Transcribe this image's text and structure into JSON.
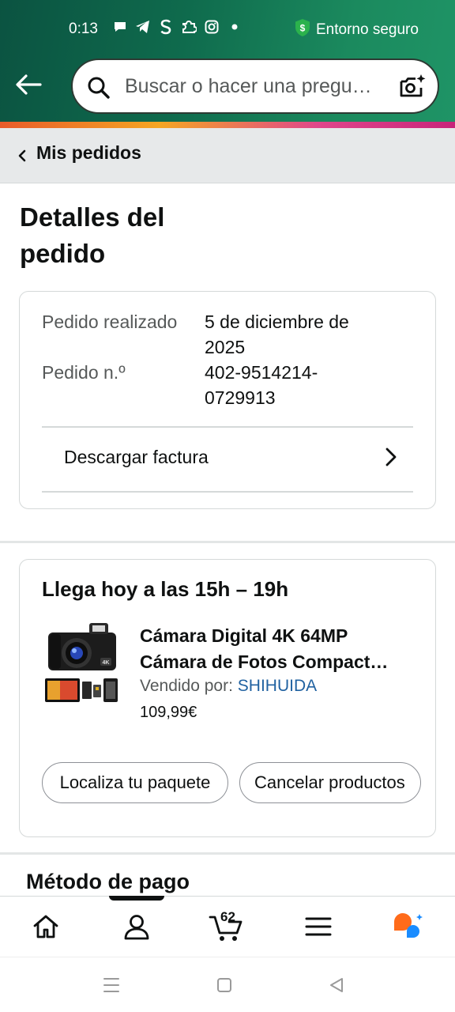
{
  "status_bar": {
    "time": "0:13",
    "secure_label": "Entorno seguro",
    "icons": [
      "chat-icon",
      "telegram-icon",
      "s-icon",
      "puzzle-icon",
      "instagram-icon",
      "dot-icon"
    ],
    "secure_color": "#2bb24c"
  },
  "header": {
    "search_placeholder": "Buscar o hacer una pregu…",
    "gradient_start": "#0b5341",
    "gradient_end": "#1f9466"
  },
  "breadcrumb": {
    "label": "Mis pedidos"
  },
  "page": {
    "title": "Detalles del pedido"
  },
  "order": {
    "placed_label": "Pedido realizado",
    "placed_value": "5 de diciembre de 2025",
    "number_label": "Pedido n.º",
    "number_value": "402-9514214-0729913",
    "invoice_label": "Descargar factura"
  },
  "delivery": {
    "title": "Llega hoy a las 15h – 19h",
    "product_title_line1": "Cámara Digital 4K 64MP",
    "product_title_line2": "Cámara de Fotos Compact…",
    "seller_prefix": "Vendido por: ",
    "seller_name": "SHIHUIDA",
    "price": "109,99€",
    "track_button": "Localiza tu paquete",
    "cancel_button": "Cancelar productos"
  },
  "payment": {
    "title": "Método de pago"
  },
  "bottom_nav": {
    "items": [
      "home-icon",
      "account-icon",
      "cart-icon",
      "menu-icon",
      "rufus-icon"
    ],
    "cart_count": "62",
    "active_index": 1
  },
  "colors": {
    "link": "#2162a1",
    "text": "#0f1111",
    "muted": "#565959"
  }
}
